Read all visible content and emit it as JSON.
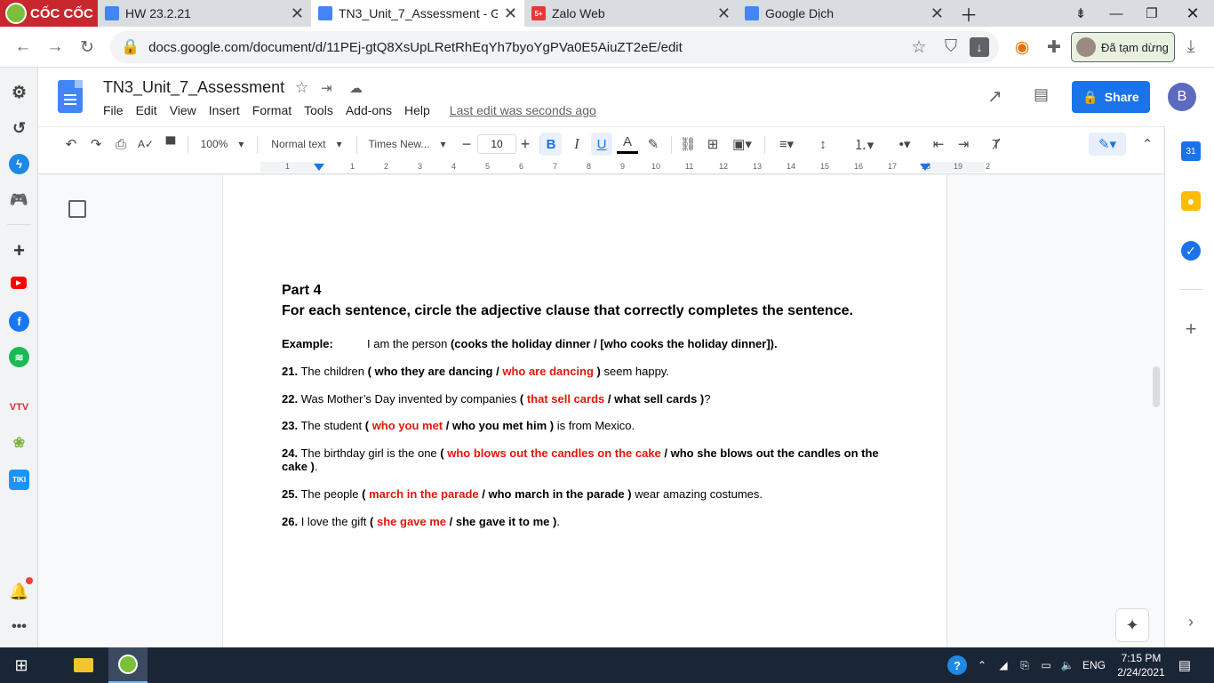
{
  "browser": {
    "brand": "CỐC CỐC",
    "tabs": [
      {
        "title": "HW 23.2.21"
      },
      {
        "title": "TN3_Unit_7_Assessment - Goo"
      },
      {
        "title": "Zalo Web"
      },
      {
        "title": "Google Dịch"
      }
    ],
    "zalo_badge": "5+",
    "url": "docs.google.com/document/d/11PEj-gtQ8XsUpLRetRhEqYh7byoYgPVa0E5AiuZT2eE/edit",
    "paused_label": "Đã tạm dừng"
  },
  "docs": {
    "title": "TN3_Unit_7_Assessment",
    "menu": [
      "File",
      "Edit",
      "View",
      "Insert",
      "Format",
      "Tools",
      "Add-ons",
      "Help"
    ],
    "last_edit": "Last edit was seconds ago",
    "share_label": "Share",
    "account_initial": "B",
    "toolbar": {
      "zoom": "100%",
      "style": "Normal text",
      "font": "Times New...",
      "font_size": "10"
    },
    "ruler": [
      "1",
      "1",
      "2",
      "3",
      "4",
      "5",
      "6",
      "7",
      "8",
      "9",
      "10",
      "11",
      "12",
      "13",
      "14",
      "15",
      "16",
      "17",
      "18",
      "19",
      "2"
    ]
  },
  "document": {
    "part_title": "Part 4",
    "instruction": "For each sentence, circle the adjective clause that correctly completes the sentence.",
    "example": {
      "label": "Example:",
      "text": "I am the person",
      "choice": "(cooks the holiday dinner / [who cooks the holiday dinner])."
    },
    "questions": [
      {
        "num": "21.",
        "pre": "The children",
        "open": " ( ",
        "a": "who they are dancing",
        "sep": " / ",
        "b": "who are dancing",
        "close": " )",
        "post": " seem happy.",
        "correct": "b"
      },
      {
        "num": "22.",
        "pre": "Was Mother’s Day invented by companies",
        "open": " ( ",
        "a": "that sell cards",
        "sep": " / ",
        "b": "what sell cards",
        "close": " )",
        "post": "?",
        "correct": "a"
      },
      {
        "num": "23.",
        "pre": "The student",
        "open": " ( ",
        "a": "who you met",
        "sep": " / ",
        "b": "who you met him",
        "close": " )",
        "post": " is from Mexico.",
        "correct": "a"
      },
      {
        "num": "24.",
        "pre": "The birthday girl is the one",
        "open": " ( ",
        "a": "who blows out the candles on the cake",
        "sep": " / ",
        "b": "who she blows out the candles on the cake",
        "close": " )",
        "post": ".",
        "correct": "a"
      },
      {
        "num": "25.",
        "pre": "The people",
        "open": " ( ",
        "a": "march in the parade",
        "sep": " / ",
        "b": "who march in the parade",
        "close": " )",
        "post": " wear amazing costumes.",
        "correct": "a"
      },
      {
        "num": "26.",
        "pre": "I love the gift",
        "open": " ( ",
        "a": "she gave me",
        "sep": " / ",
        "b": "she gave it to me",
        "close": " )",
        "post": ".",
        "correct": "a"
      }
    ]
  },
  "taskbar": {
    "lang": "ENG",
    "time": "7:15 PM",
    "date": "2/24/2021"
  },
  "colors": {
    "accent": "#1a73e8",
    "answer": "#e3170a",
    "coccoc": "#c9272e",
    "taskbar": "#1a2536"
  }
}
